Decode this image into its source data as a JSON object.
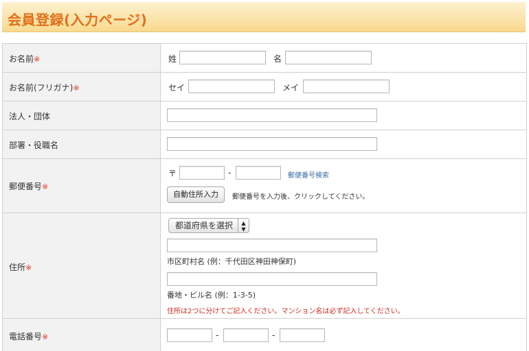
{
  "page_title": "会員登録(入力ページ)",
  "required_mark": "※",
  "rows": {
    "name": {
      "label": "お名前",
      "sei_label": "姓",
      "mei_label": "名"
    },
    "name_kana": {
      "label": "お名前(フリガナ)",
      "sei_label": "セイ",
      "mei_label": "メイ"
    },
    "company": {
      "label": "法人・団体"
    },
    "department": {
      "label": "部署・役職名"
    },
    "postal": {
      "label": "郵便番号",
      "prefix": "〒",
      "separator": "-",
      "search_link": "郵便番号検索",
      "auto_button": "自動住所入力",
      "hint": "郵便番号を入力後、クリックしてください。"
    },
    "address": {
      "label": "住所",
      "prefecture_select": "都道府県を選択",
      "city_hint": "市区町村名 (例：千代田区神田神保町)",
      "street_hint": "番地・ビル名 (例：1-3-5)",
      "note": "住所は2つに分けてご記入ください。マンション名は必ず記入してください。"
    },
    "phone": {
      "label": "電話番号",
      "separator": "-"
    }
  }
}
